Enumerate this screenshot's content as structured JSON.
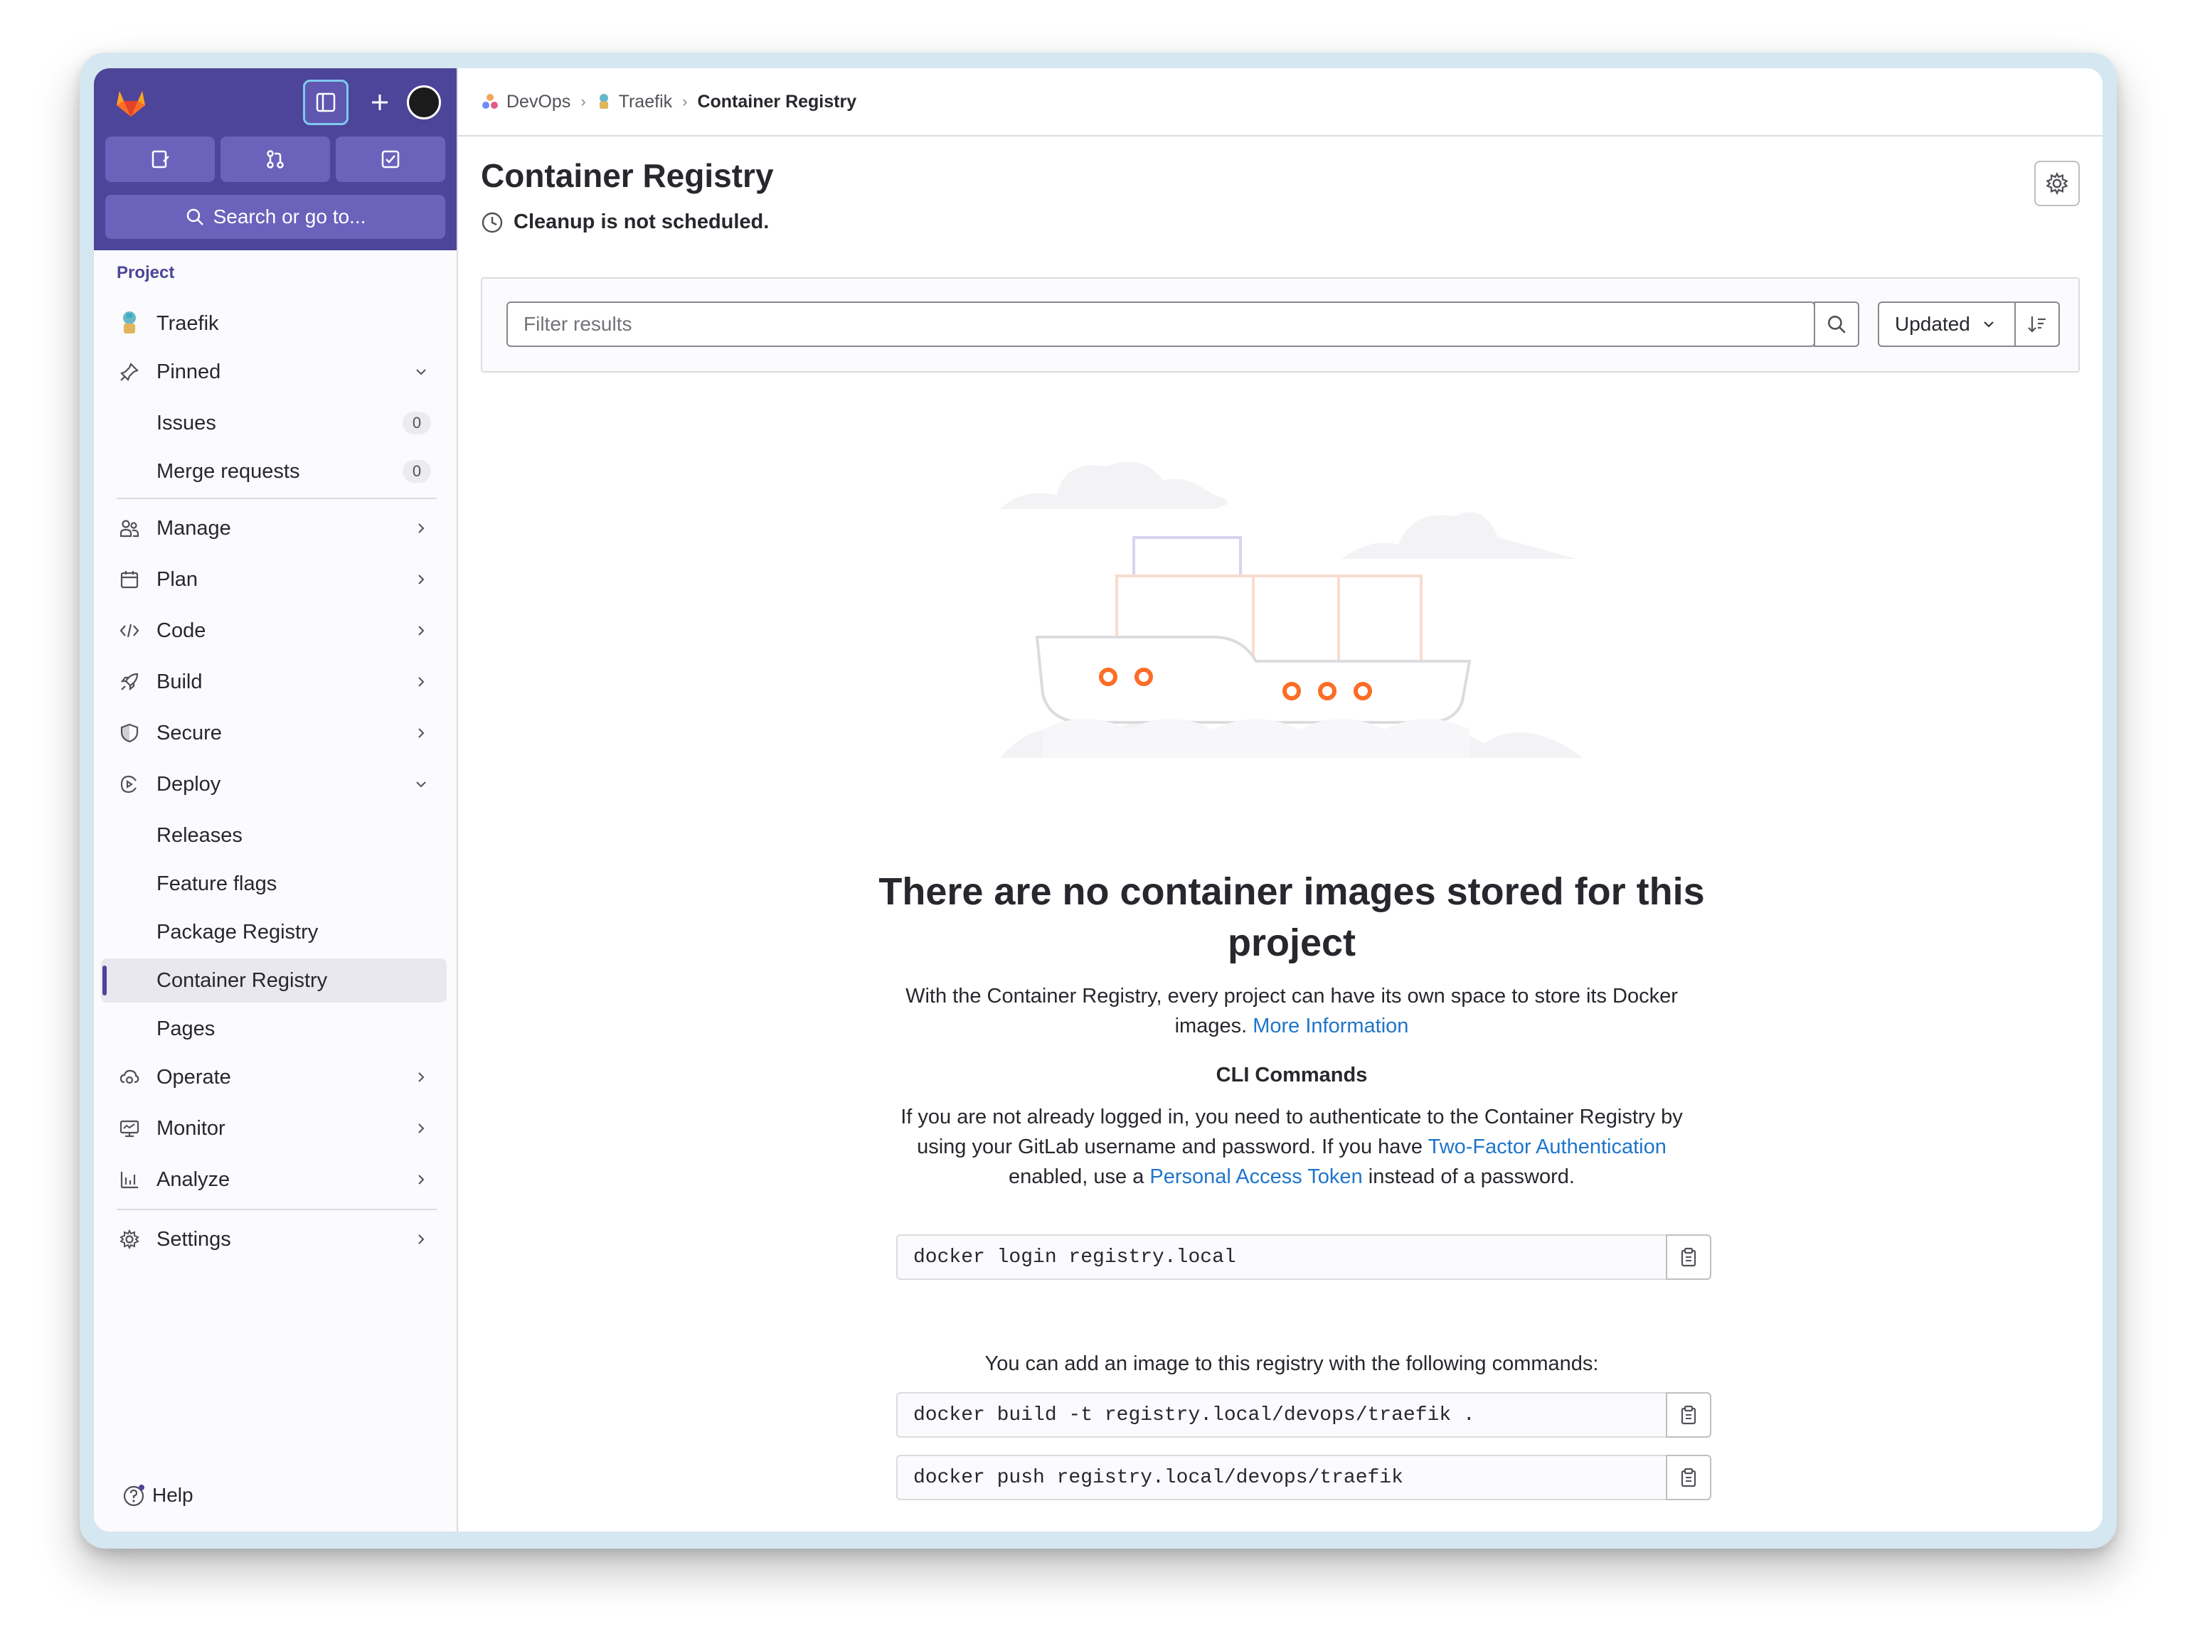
{
  "sidebar": {
    "search_label": "Search or go to...",
    "section_label": "Project",
    "project_name": "Traefik",
    "items": {
      "pinned": "Pinned",
      "issues": "Issues",
      "issues_count": "0",
      "merge_requests": "Merge requests",
      "merge_requests_count": "0",
      "manage": "Manage",
      "plan": "Plan",
      "code": "Code",
      "build": "Build",
      "secure": "Secure",
      "deploy": "Deploy",
      "releases": "Releases",
      "feature_flags": "Feature flags",
      "package_registry": "Package Registry",
      "container_registry": "Container Registry",
      "pages": "Pages",
      "operate": "Operate",
      "monitor": "Monitor",
      "analyze": "Analyze",
      "settings": "Settings"
    },
    "help": "Help"
  },
  "breadcrumb": {
    "group": "DevOps",
    "project": "Traefik",
    "current": "Container Registry"
  },
  "page": {
    "title": "Container Registry",
    "cleanup_status": "Cleanup is not scheduled."
  },
  "filter": {
    "placeholder": "Filter results",
    "sort_label": "Updated"
  },
  "empty_state": {
    "title": "There are no container images stored for this project",
    "desc_prefix": "With the Container Registry, every project can have its own space to store its Docker images.",
    "more_info_link": "More Information",
    "cli_heading": "CLI Commands",
    "cli_desc_part1": "If you are not already logged in, you need to authenticate to the Container Registry by using your GitLab username and password. If you have",
    "two_factor_link": "Two-Factor Authentication",
    "cli_desc_part2": "enabled, use a",
    "pat_link": "Personal Access Token",
    "cli_desc_part3": "instead of a password.",
    "login_cmd": "docker login registry.local",
    "add_image_text": "You can add an image to this registry with the following commands:",
    "build_cmd": "docker build -t registry.local/devops/traefik .",
    "push_cmd": "docker push registry.local/devops/traefik"
  },
  "colors": {
    "sidebar_top": "#4d4599",
    "link": "#1f75cb",
    "ship_accent": "#fc6d26"
  }
}
